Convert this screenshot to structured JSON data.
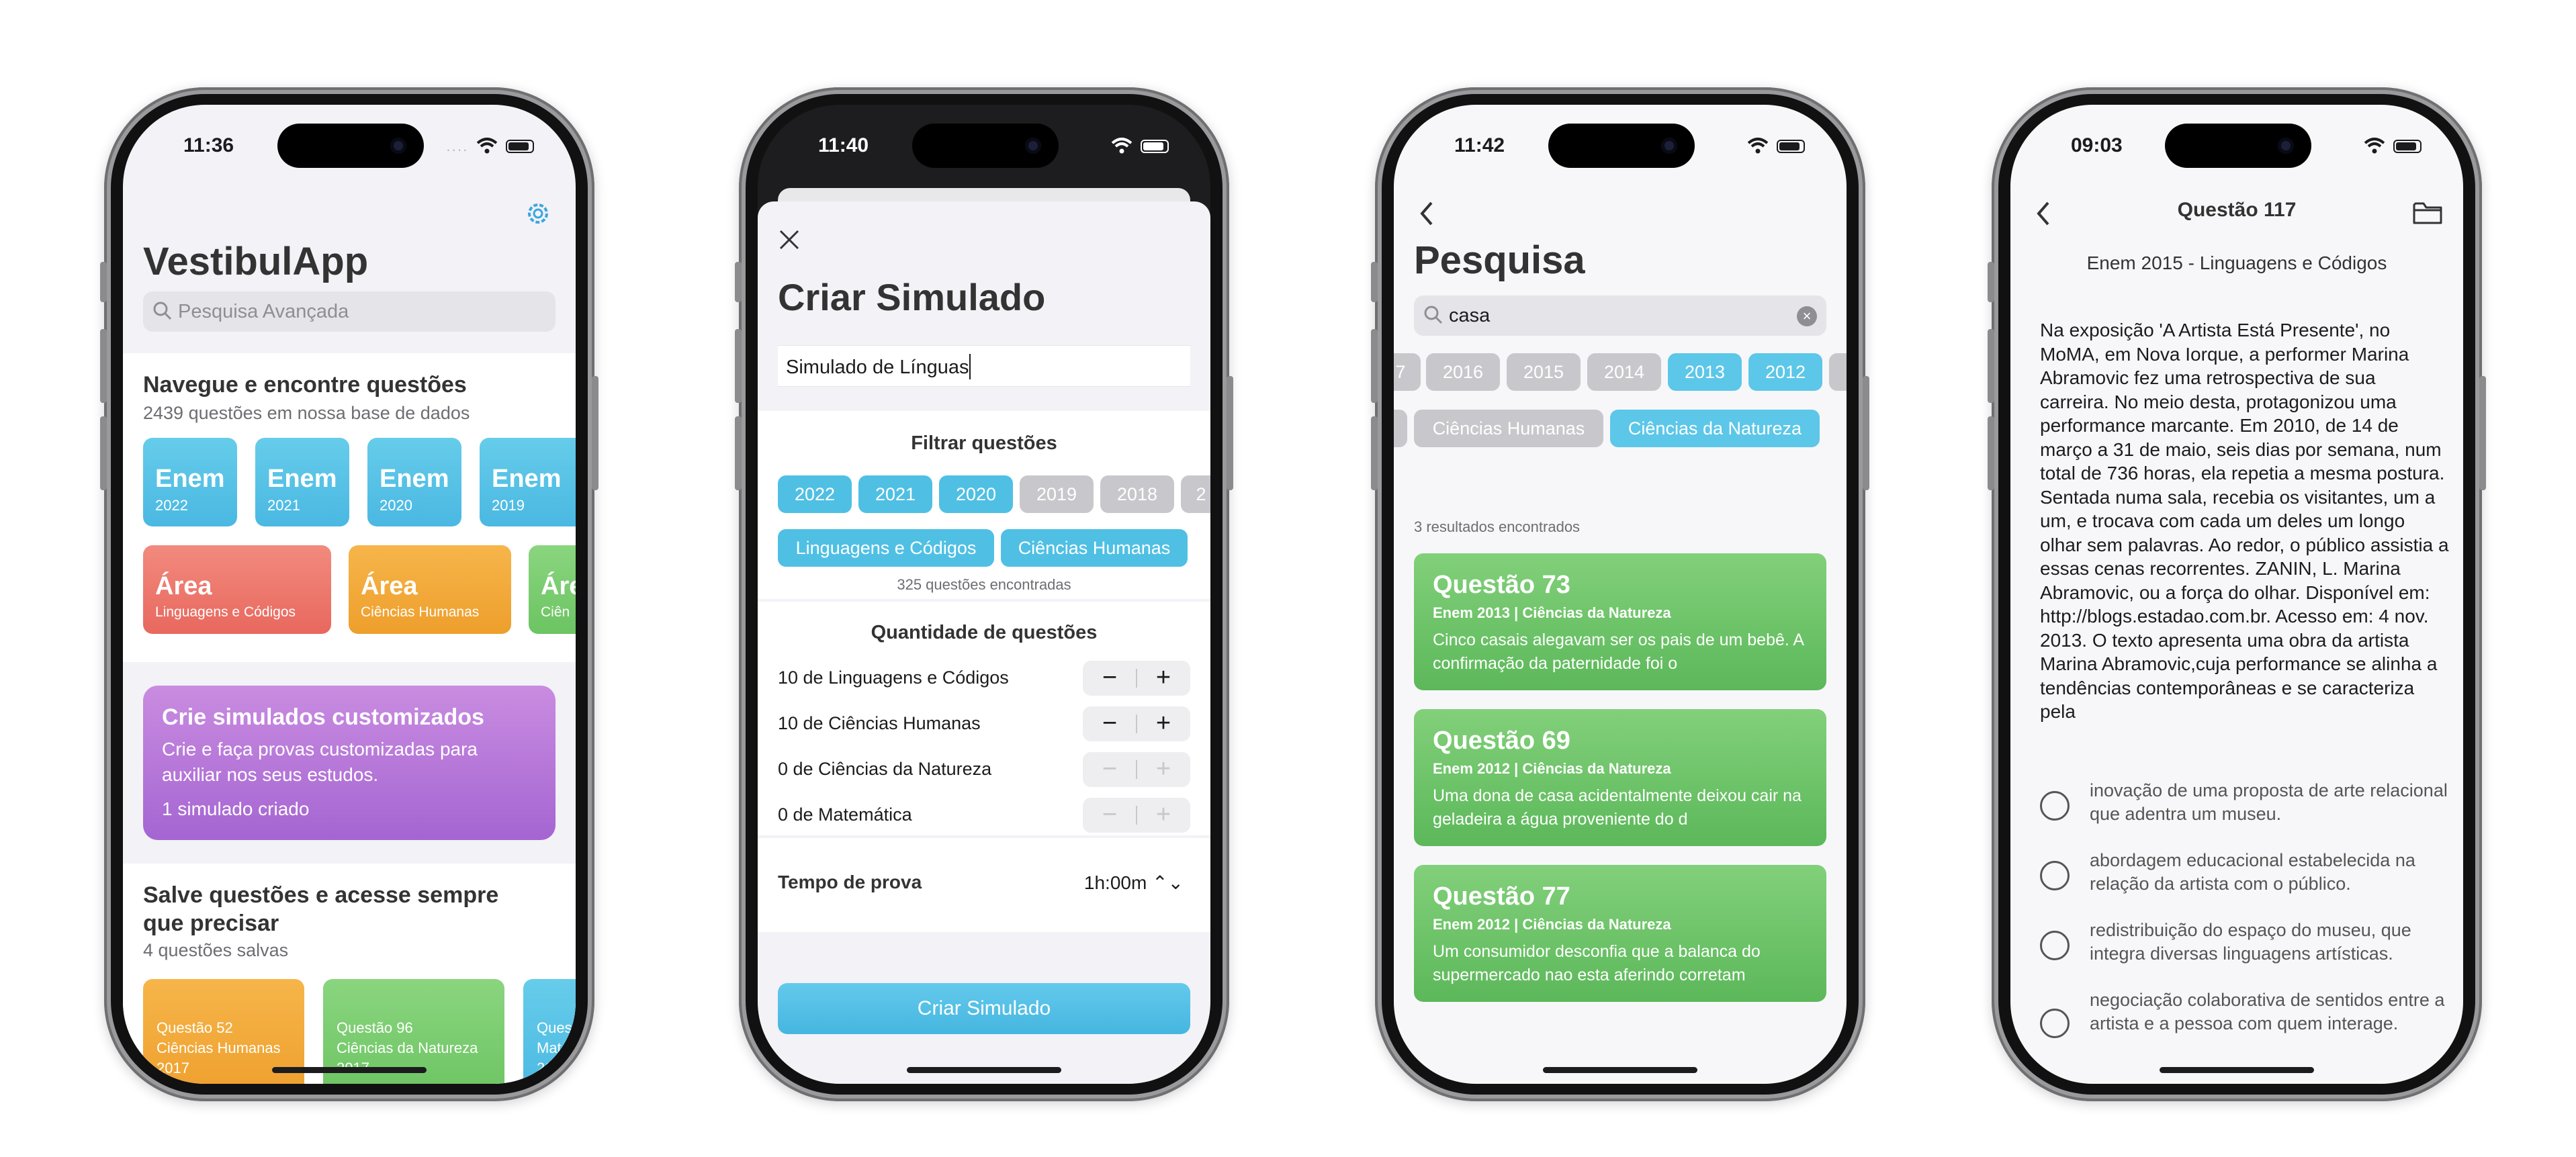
{
  "colors": {
    "enem_blue": "#5cc7e8",
    "area_red": "#ee7a70",
    "area_orange": "#f2a93b",
    "area_green": "#7cce73",
    "custom_purple": "#b478da",
    "question_green": "#6ec46a",
    "chip_inactive": "#c8c8cc"
  },
  "phone1": {
    "time": "11:36",
    "app_title": "VestibulApp",
    "search_placeholder": "Pesquisa Avançada",
    "browse": {
      "title": "Navegue e encontre questões",
      "subtitle": "2439 questões em nossa base de dados"
    },
    "enem_tiles": [
      {
        "label": "Enem",
        "year": "2022"
      },
      {
        "label": "Enem",
        "year": "2021"
      },
      {
        "label": "Enem",
        "year": "2020"
      },
      {
        "label": "Enem",
        "year": "2019"
      }
    ],
    "area_tiles": [
      {
        "label": "Área",
        "sub": "Linguagens e Códigos"
      },
      {
        "label": "Área",
        "sub": "Ciências Humanas"
      },
      {
        "label": "Áre",
        "sub": "Ciên"
      }
    ],
    "custom": {
      "title": "Crie simulados customizados",
      "description": "Crie e faça provas customizadas para auxiliar nos seus estudos.",
      "count": "1 simulado criado"
    },
    "saved": {
      "title": "Salve questões e acesse sempre que precisar",
      "subtitle": "4 questões salvas"
    },
    "saved_cards": [
      {
        "q": "Questão 52",
        "area": "Ciências Humanas",
        "year": "2017"
      },
      {
        "q": "Questão 96",
        "area": "Ciências da Natureza",
        "year": "2017"
      },
      {
        "q": "Ques",
        "area": "Mate",
        "year": "201"
      }
    ]
  },
  "phone2": {
    "time": "11:40",
    "title": "Criar Simulado",
    "name_value": "Simulado de Línguas",
    "filter_title": "Filtrar questões",
    "year_chips": [
      {
        "label": "2022",
        "active": true
      },
      {
        "label": "2021",
        "active": true
      },
      {
        "label": "2020",
        "active": true
      },
      {
        "label": "2019",
        "active": false
      },
      {
        "label": "2018",
        "active": false
      },
      {
        "label": "2",
        "active": false
      }
    ],
    "area_chips": [
      {
        "label": "Linguagens e Códigos",
        "active": true
      },
      {
        "label": "Ciências Humanas",
        "active": true
      }
    ],
    "found": "325 questões encontradas",
    "quantity_title": "Quantidade de questões",
    "quantities": [
      {
        "label": "10 de Linguagens e Códigos",
        "enabled": true
      },
      {
        "label": "10 de Ciências Humanas",
        "enabled": true
      },
      {
        "label": "0 de Ciências da Natureza",
        "enabled": false
      },
      {
        "label": "0 de Matemática",
        "enabled": false
      }
    ],
    "stepper_minus": "−",
    "stepper_plus": "+",
    "time_label": "Tempo de prova",
    "time_value": "1h:00m ⌃⌄",
    "create_button": "Criar Simulado"
  },
  "phone3": {
    "time": "11:42",
    "title": "Pesquisa",
    "search_value": "casa",
    "clear": "×",
    "year_chips": [
      {
        "label": "7",
        "active": false
      },
      {
        "label": "2016",
        "active": false
      },
      {
        "label": "2015",
        "active": false
      },
      {
        "label": "2014",
        "active": false
      },
      {
        "label": "2013",
        "active": true
      },
      {
        "label": "2012",
        "active": true
      }
    ],
    "area_chips": [
      {
        "label": "Ciências Humanas",
        "active": false
      },
      {
        "label": "Ciências da Natureza",
        "active": true
      }
    ],
    "results": "3 resultados encontrados",
    "cards": [
      {
        "title": "Questão 73",
        "meta": "Enem 2013 | Ciências da Natureza",
        "desc": "Cinco casais alegavam ser os pais de um bebê. A confirmação da paternidade foi o"
      },
      {
        "title": "Questão 69",
        "meta": "Enem 2012 | Ciências da Natureza",
        "desc": "Uma dona de casa acidentalmente deixou cair na geladeira a água proveniente do d"
      },
      {
        "title": "Questão 77",
        "meta": "Enem 2012 | Ciências da Natureza",
        "desc": "Um consumidor desconfia que a balanca do supermercado nao esta aferindo corretam"
      }
    ]
  },
  "phone4": {
    "time": "09:03",
    "nav_title": "Questão 117",
    "exam": "Enem 2015 - Linguagens e Códigos",
    "statement": "Na exposição 'A Artista Está Presente', no MoMA, em Nova Iorque, a performer Marina Abramovic fez uma retrospectiva de sua carreira. No meio desta, protagonizou uma performance marcante. Em 2010, de 14 de março a 31 de maio, seis dias por semana, num total de 736 horas, ela repetia a mesma postura. Sentada numa sala, recebia os visitantes, um a um, e trocava com cada um deles um longo olhar sem palavras. Ao redor, o público assistia a essas cenas recorrentes. ZANIN, L. Marina Abramovic, ou a força do olhar. Disponível em: http://blogs.estadao.com.br. Acesso em: 4 nov. 2013. O texto apresenta uma obra da artista Marina Abramovic,cuja performance se alinha a tendências contemporâneas e se caracteriza pela",
    "options": [
      "inovação de uma proposta de arte relacional que adentra um museu.",
      "abordagem educacional estabelecida na relação da artista com o público.",
      "redistribuição do espaço do museu, que integra diversas linguagens artísticas.",
      "negociação colaborativa de sentidos entre a artista e a pessoa com quem interage."
    ]
  }
}
